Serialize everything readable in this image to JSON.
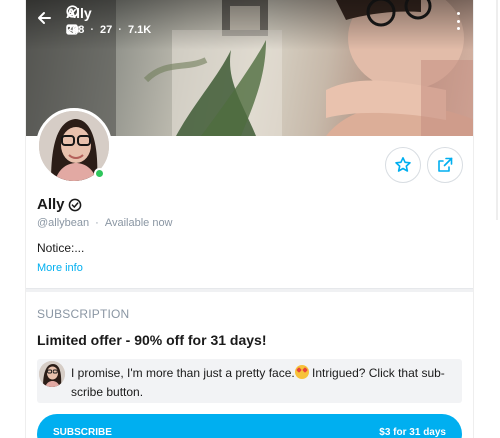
{
  "cover": {
    "name": "Ally",
    "stats": [
      {
        "icon": "image-icon",
        "value": "268"
      },
      {
        "icon": "video-icon",
        "value": "27"
      },
      {
        "icon": "heart-icon",
        "value": "7.1K"
      }
    ]
  },
  "profile": {
    "name": "Ally",
    "handle": "@allybean",
    "separator": "·",
    "status": "Available now",
    "notice": "Notice:...",
    "more_info": "More info"
  },
  "subscription": {
    "section_title": "SUBSCRIPTION",
    "offer": "Limited offer - 90% off for 31 days!",
    "message_before_emoji": "I promise, I'm more than just a pretty face.",
    "message_after_emoji": " Intrigued? Click that sub- scribe button.",
    "subscribe_label": "SUBSCRIBE",
    "price": "$3 for 31 days"
  },
  "colors": {
    "accent": "#00aff0",
    "online": "#2ec55b",
    "muted_text": "#8a96a3"
  }
}
